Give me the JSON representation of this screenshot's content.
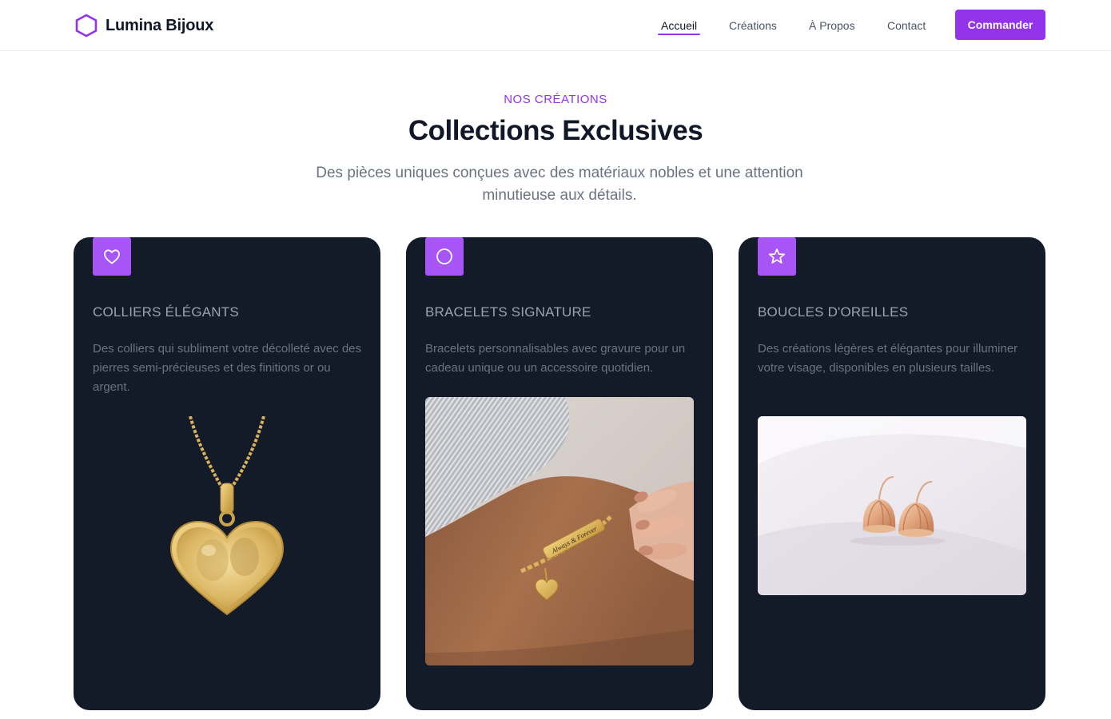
{
  "header": {
    "brand": "Lumina Bijoux",
    "nav": [
      "Accueil",
      "Créations",
      "À Propos",
      "Contact"
    ],
    "cta": "Commander"
  },
  "intro": {
    "eyebrow": "Nos Créations",
    "title": "Collections Exclusives",
    "subtitle": "Des pièces uniques conçues avec des matériaux nobles et une attention minutieuse aux détails."
  },
  "cards": [
    {
      "icon": "heart-icon",
      "title": "Colliers Élégants",
      "desc": "Des colliers qui subliment votre décolleté avec des pierres semi-précieuses et des finitions or ou argent.",
      "image": "gold-heart-pendant-necklace"
    },
    {
      "icon": "circle-icon",
      "title": "Bracelets Signature",
      "desc": "Bracelets personnalisables avec gravure pour un cadeau unique ou un accessoire quotidien.",
      "image": "engraved-gold-bracelet-on-wrist",
      "engraving": "Always & Forever"
    },
    {
      "icon": "star-icon",
      "title": "Boucles d'Oreilles",
      "desc": "Des créations légères et élégantes pour illuminer votre visage, disponibles en plusieurs tailles.",
      "image": "rose-gold-drop-earrings"
    }
  ],
  "colors": {
    "accent": "#9333ea",
    "icon_bg": "#a855f7",
    "card_bg": "#131a28",
    "text_dark": "#111827",
    "text_muted": "#6b7280"
  }
}
